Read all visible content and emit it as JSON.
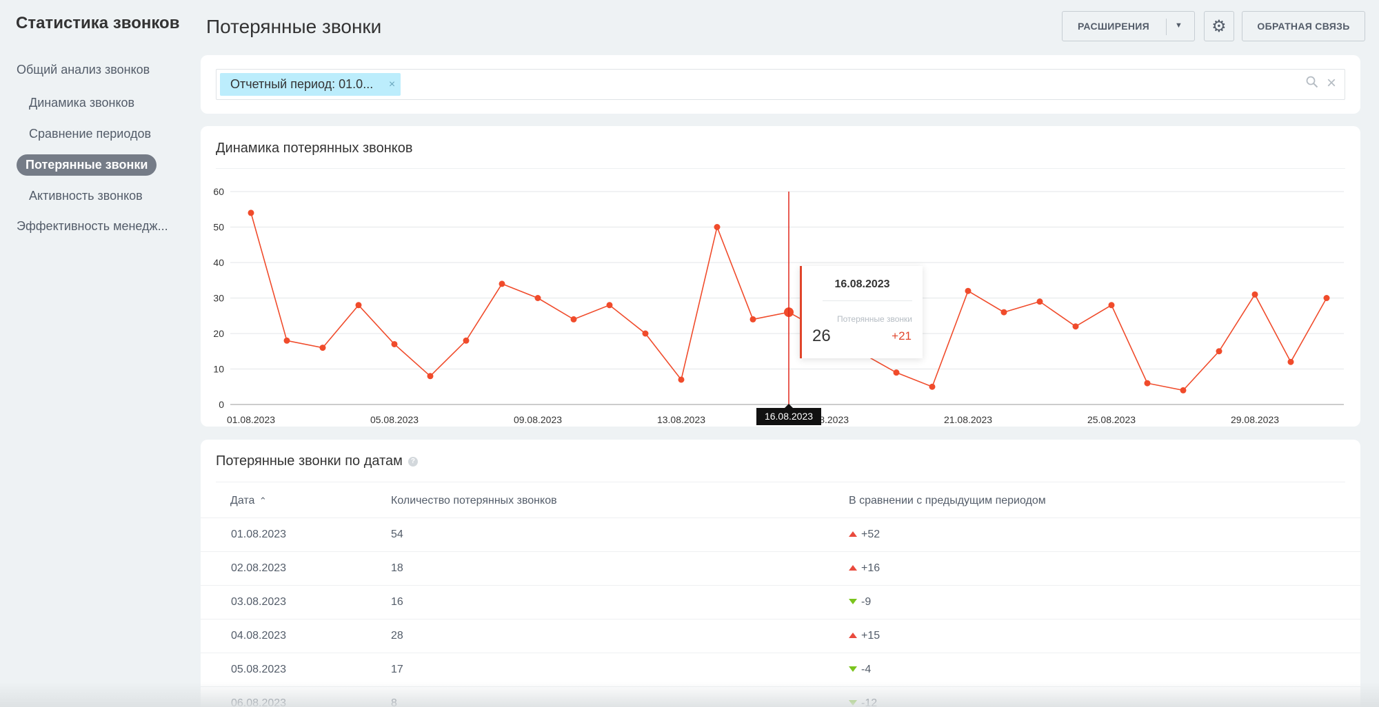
{
  "sidebar": {
    "app_title": "Статистика звонков",
    "items": [
      {
        "label": "Общий анализ звонков"
      },
      {
        "label": "Динамика звонков"
      },
      {
        "label": "Сравнение периодов"
      },
      {
        "label": "Потерянные звонки"
      },
      {
        "label": "Активность звонков"
      },
      {
        "label": "Эффективность менедж..."
      }
    ],
    "active_item": "Потерянные звонки"
  },
  "header": {
    "title": "Потерянные звонки",
    "extensions_label": "РАСШИРЕНИЯ",
    "feedback_label": "ОБРАТНАЯ СВЯЗЬ",
    "settings_icon": "gear-icon"
  },
  "filter": {
    "chip_label": "Отчетный период: 01.0...",
    "chip_close": "×",
    "search_icon": "⚲",
    "clear_icon": "×"
  },
  "chart_section": {
    "title": "Динамика потерянных звонков",
    "tooltip": {
      "date": "16.08.2023",
      "series_label": "Потерянные звонки",
      "value": "26",
      "delta": "+21"
    },
    "cursor_label": "16.08.2023"
  },
  "chart_data": {
    "type": "line",
    "title": "",
    "x": [
      "01.08.2023",
      "02.08.2023",
      "03.08.2023",
      "04.08.2023",
      "05.08.2023",
      "06.08.2023",
      "07.08.2023",
      "08.08.2023",
      "09.08.2023",
      "10.08.2023",
      "11.08.2023",
      "12.08.2023",
      "13.08.2023",
      "14.08.2023",
      "15.08.2023",
      "16.08.2023",
      "17.08.2023",
      "18.08.2023",
      "19.08.2023",
      "20.08.2023",
      "21.08.2023",
      "22.08.2023",
      "23.08.2023",
      "24.08.2023",
      "25.08.2023",
      "26.08.2023",
      "27.08.2023",
      "28.08.2023",
      "29.08.2023",
      "30.08.2023",
      "31.08.2023"
    ],
    "series": [
      {
        "values": [
          54,
          18,
          16,
          28,
          17,
          8,
          18,
          34,
          30,
          24,
          28,
          20,
          7,
          50,
          24,
          26,
          null,
          null,
          9,
          5,
          32,
          26,
          29,
          22,
          28,
          6,
          4,
          15,
          31,
          12,
          30
        ]
      }
    ],
    "x_tick_labels": [
      "01.08.2023",
      "05.08.2023",
      "09.08.2023",
      "13.08.2023",
      "17.08.2023",
      "21.08.2023",
      "25.08.2023",
      "29.08.2023"
    ],
    "y_ticks": [
      0,
      10,
      20,
      30,
      40,
      50,
      60
    ],
    "ylim": [
      0,
      60
    ],
    "grid": true,
    "highlight_index": 15,
    "color": "#f04b2b"
  },
  "table_section": {
    "title": "Потерянные звонки по датам",
    "help_icon": "?",
    "columns": {
      "date": "Дата",
      "count": "Количество потерянных звонков",
      "compare": "В сравнении с предыдущим периодом"
    },
    "sort_indicator": "⌃",
    "rows": [
      {
        "date": "01.08.2023",
        "count": "54",
        "delta": "+52",
        "dir": "up"
      },
      {
        "date": "02.08.2023",
        "count": "18",
        "delta": "+16",
        "dir": "up"
      },
      {
        "date": "03.08.2023",
        "count": "16",
        "delta": "-9",
        "dir": "down"
      },
      {
        "date": "04.08.2023",
        "count": "28",
        "delta": "+15",
        "dir": "up"
      },
      {
        "date": "05.08.2023",
        "count": "17",
        "delta": "-4",
        "dir": "down"
      },
      {
        "date": "06.08.2023",
        "count": "8",
        "delta": "-12",
        "dir": "down"
      }
    ]
  },
  "colors": {
    "accent": "#f04b2b",
    "up": "#e94a3d",
    "down": "#7ac41d",
    "chip": "#bcedfc",
    "active_nav": "#757c87"
  }
}
